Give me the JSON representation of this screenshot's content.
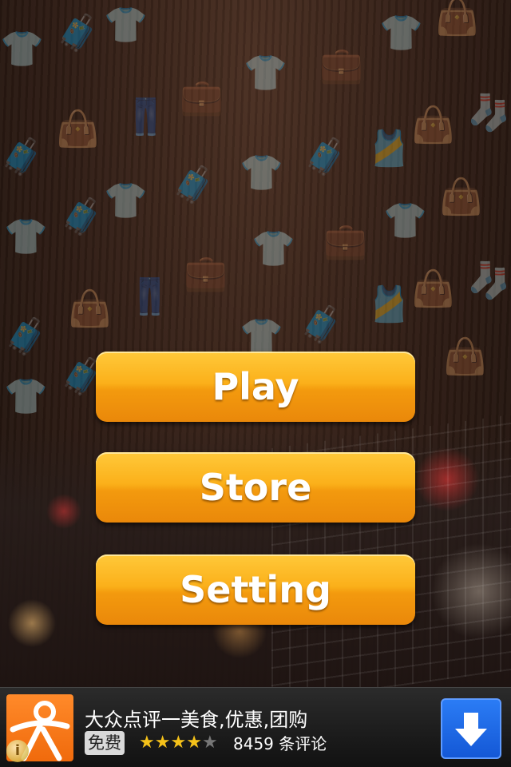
{
  "menu": {
    "play_label": "Play",
    "store_label": "Store",
    "setting_label": "Setting",
    "button_color": "#f7a51a"
  },
  "ad": {
    "title": "大众点评一美食,优惠,团购",
    "price_badge": "免费",
    "rating": 4,
    "rating_max": 5,
    "reviews": "8459 条评论",
    "info_label": "i",
    "logo_icon": "dianping-logo-icon",
    "download_icon": "download-arrow-icon",
    "logo_color": "#f47a1a",
    "download_color": "#1f6be8"
  },
  "background": {
    "pattern_icons": [
      "tshirt-icon",
      "shopping-bag-icon",
      "suitcase-icon",
      "pants-icon",
      "briefcase-icon",
      "socks-icon",
      "tank-top-icon"
    ]
  }
}
